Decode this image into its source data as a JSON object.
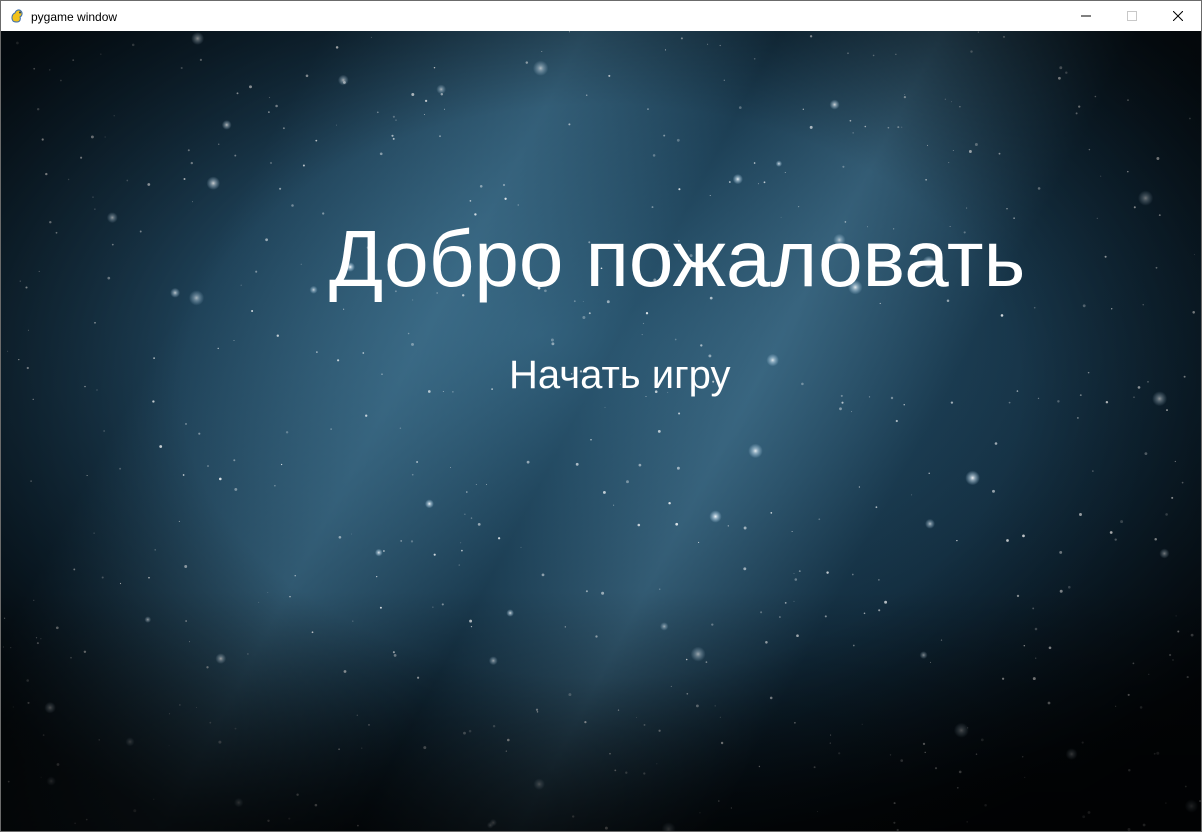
{
  "window": {
    "title": "pygame window",
    "icon": "pygame-snake-icon",
    "controls": [
      "minimize-icon",
      "maximize-icon",
      "close-icon"
    ]
  },
  "game": {
    "background": "starfield",
    "welcome_text": "Добро пожаловать",
    "start_label": "Начать игру",
    "text_color": "#ffffff"
  }
}
